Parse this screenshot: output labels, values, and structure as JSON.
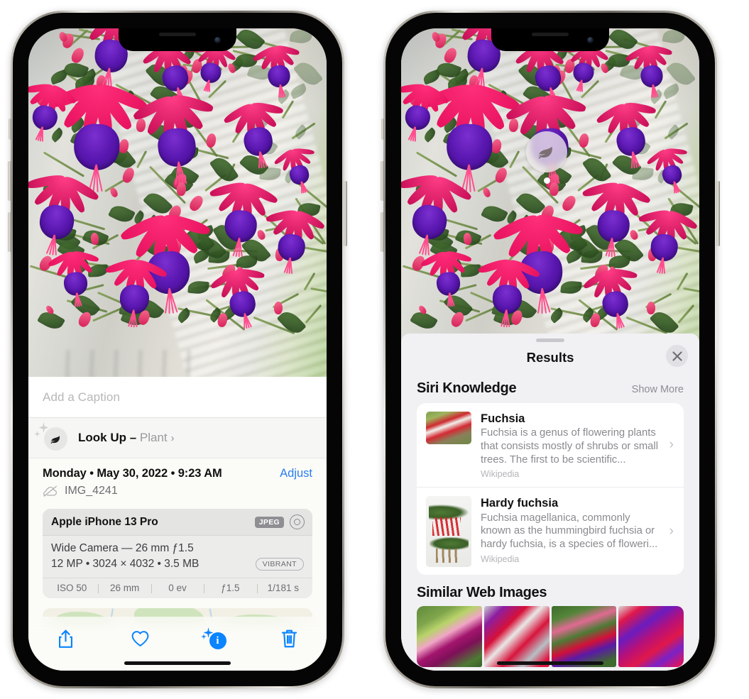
{
  "left_phone": {
    "caption_field": {
      "placeholder": "Add a Caption",
      "value": ""
    },
    "lookup_row": {
      "icon": "leaf-icon",
      "sparkle_icon": "sparkles-icon",
      "label": "Look Up – ",
      "subject": "Plant",
      "chevron": "›"
    },
    "metadata": {
      "date_line": "Monday • May 30, 2022 • 9:23 AM",
      "adjust_label": "Adjust",
      "cloud_icon": "cloud-slash-icon",
      "filename": "IMG_4241"
    },
    "exif": {
      "device": "Apple iPhone 13 Pro",
      "format_tag": "JPEG",
      "lens_icon": "lens-icon",
      "lens_line": "Wide Camera — 26 mm ƒ1.5",
      "size_line": "12 MP • 3024 × 4032 • 3.5 MB",
      "style_tag": "VIBRANT",
      "settings": [
        "ISO 50",
        "26 mm",
        "0 ev",
        "ƒ1.5",
        "1/181 s"
      ]
    },
    "toolbar": {
      "share_icon": "share-icon",
      "favorite_icon": "heart-icon",
      "info_icon": "info-sparkle-icon",
      "info_glyph": "i",
      "delete_icon": "trash-icon"
    }
  },
  "right_phone": {
    "photo_badge": {
      "icon": "leaf-icon",
      "name": "visual-lookup-leaf-badge"
    },
    "sheet": {
      "title": "Results",
      "close_icon": "close-icon",
      "grabber": "drag-handle"
    },
    "siri_knowledge": {
      "section_title": "Siri Knowledge",
      "show_more": "Show More",
      "cards": [
        {
          "title": "Fuchsia",
          "description": "Fuchsia is a genus of flowering plants that consists mostly of shrubs or small trees. The first to be scientific...",
          "source": "Wikipedia",
          "chevron": "›"
        },
        {
          "title": "Hardy fuchsia",
          "description": "Fuchsia magellanica, commonly known as the hummingbird fuchsia or hardy fuchsia, is a species of floweri...",
          "source": "Wikipedia",
          "chevron": "›"
        }
      ]
    },
    "similar_web_images": {
      "section_title": "Similar Web Images",
      "thumbnails": [
        "web-image-1",
        "web-image-2",
        "web-image-3",
        "web-image-4"
      ]
    }
  },
  "colors": {
    "accent_blue": "#0a84ff",
    "link_blue": "#2a7df0",
    "sheet_bg": "#f1f1f4",
    "card_bg": "#ffffff",
    "secondary_text": "#8a8a8f",
    "tag_gray": "#8e8e93"
  }
}
